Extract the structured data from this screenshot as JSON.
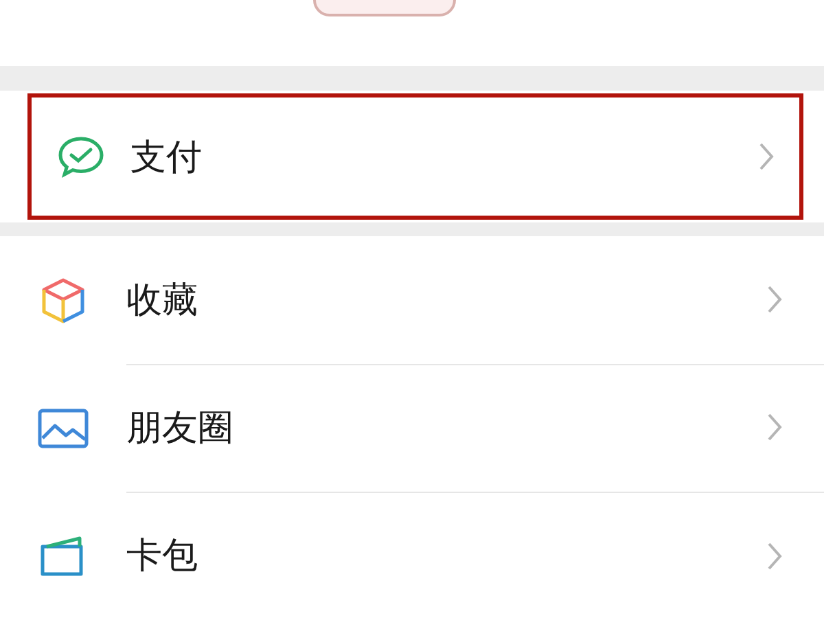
{
  "groups": [
    {
      "items": [
        {
          "label": "支付",
          "kind": "pay",
          "highlighted": true
        }
      ]
    },
    {
      "items": [
        {
          "label": "收藏",
          "kind": "favorites",
          "highlighted": false
        },
        {
          "label": "朋友圈",
          "kind": "moments",
          "highlighted": false
        },
        {
          "label": "卡包",
          "kind": "cards",
          "highlighted": false
        }
      ]
    }
  ]
}
